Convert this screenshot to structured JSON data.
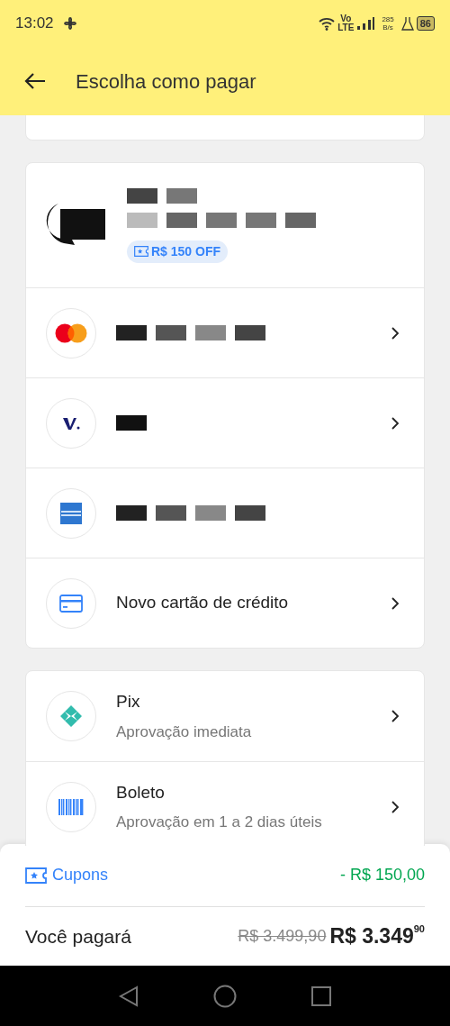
{
  "status_bar": {
    "time": "13:02",
    "network_top": "Vo",
    "network_bottom": "LTE",
    "rate": "285",
    "rate_unit": "B/s",
    "battery": "86"
  },
  "header": {
    "title": "Escolha como pagar"
  },
  "payment_groups": [
    {
      "methods": [
        {
          "kind": "account",
          "badge": "R$ 150 OFF",
          "chevron": false
        },
        {
          "kind": "mastercard",
          "chevron": true
        },
        {
          "kind": "visa",
          "chevron": true
        },
        {
          "kind": "amex",
          "chevron": false
        },
        {
          "kind": "card",
          "title": "Novo cartão de crédito",
          "chevron": true
        }
      ]
    },
    {
      "methods": [
        {
          "kind": "pix",
          "title": "Pix",
          "subtitle": "Aprovação imediata",
          "chevron": true
        },
        {
          "kind": "boleto",
          "title": "Boleto",
          "subtitle": "Aprovação em 1 a 2 dias úteis",
          "chevron": true
        }
      ]
    }
  ],
  "summary": {
    "coupons_label": "Cupons",
    "discount": "- R$ 150,00",
    "total_label": "Você pagará",
    "old_price": "R$ 3.499,90",
    "price": "R$ 3.349",
    "price_cents": "90"
  }
}
